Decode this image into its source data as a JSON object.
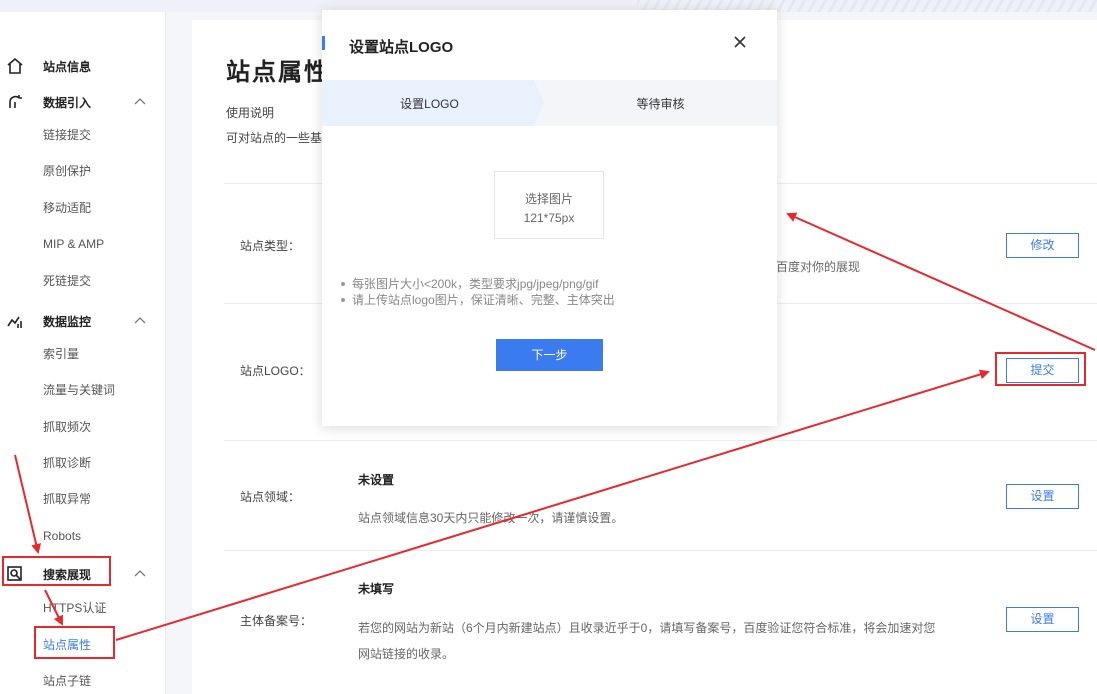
{
  "sidebar": {
    "item_site_info": "站点信息",
    "group_data_import": "数据引入",
    "import_items": [
      "链接提交",
      "原创保护",
      "移动适配",
      "MIP & AMP",
      "死链提交"
    ],
    "group_data_monitor": "数据监控",
    "monitor_items": [
      "索引量",
      "流量与关键词",
      "抓取频次",
      "抓取诊断",
      "抓取异常",
      "Robots"
    ],
    "group_search_display": "搜索展现",
    "display_items": [
      "HTTPS认证",
      "站点属性",
      "站点子链"
    ]
  },
  "main": {
    "page_title": "站点属性",
    "usage_title": "使用说明",
    "usage_desc": "可对站点的一些基",
    "rows": [
      {
        "label": "站点类型：",
        "desc": "百度对你的展现",
        "button": "修改"
      },
      {
        "label": "站点LOGO：",
        "button": "提交"
      },
      {
        "label": "站点领域：",
        "title": "未设置",
        "desc": "站点领域信息30天内只能修改一次，请谨慎设置。",
        "button": "设置"
      },
      {
        "label": "主体备案号：",
        "title": "未填写",
        "desc": "若您的网站为新站（6个月内新建站点）且收录近乎于0，请填写备案号，百度验证您符合标准，将会加速对您",
        "desc2": "网站链接的收录。",
        "button": "设置"
      }
    ]
  },
  "modal": {
    "title": "设置站点LOGO",
    "steps": [
      "设置LOGO",
      "等待审核"
    ],
    "pick_line1": "选择图片",
    "pick_line2": "121*75px",
    "tips": [
      "每张图片大小<200k，类型要求jpg/jpeg/png/gif",
      "请上传站点logo图片，保证清晰、完整、主体突出"
    ],
    "next_button": "下一步"
  },
  "colors": {
    "accent": "#3a7bf0",
    "annotation_red": "#e8282c",
    "step_active_bg": "#e8f1fc"
  }
}
